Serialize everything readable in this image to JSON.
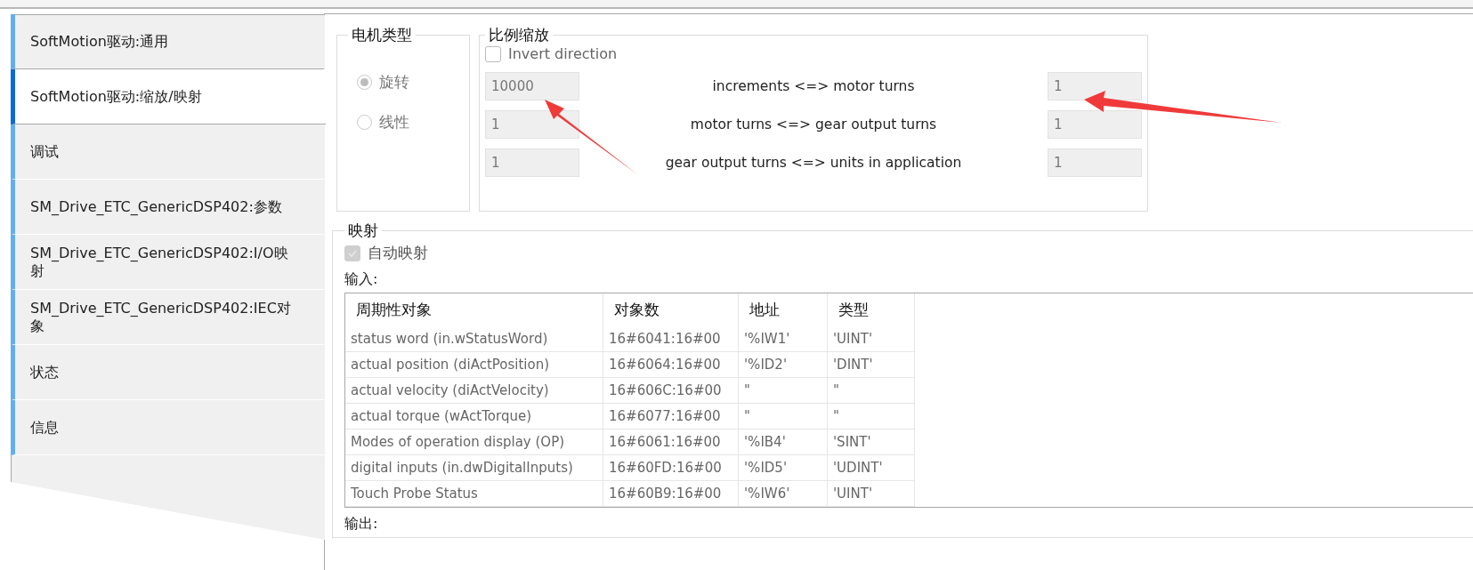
{
  "sidebar": {
    "items": [
      {
        "label": "SoftMotion驱动:通用",
        "selected": false
      },
      {
        "label": "SoftMotion驱动:缩放/映射",
        "selected": true
      },
      {
        "label": "调试",
        "selected": false
      },
      {
        "label": "SM_Drive_ETC_GenericDSP402:参数",
        "selected": false
      },
      {
        "label": "SM_Drive_ETC_GenericDSP402:I/O映射",
        "selected": false
      },
      {
        "label": "SM_Drive_ETC_GenericDSP402:IEC对象",
        "selected": false
      },
      {
        "label": "状态",
        "selected": false
      },
      {
        "label": "信息",
        "selected": false
      }
    ]
  },
  "motor_type": {
    "title": "电机类型",
    "disabled": true,
    "options": [
      {
        "label": "旋转",
        "selected": true
      },
      {
        "label": "线性",
        "selected": false
      }
    ]
  },
  "scaling": {
    "title": "比例缩放",
    "invert_direction": {
      "label": "Invert direction",
      "checked": false
    },
    "rows": [
      {
        "value": "10000",
        "label": "increments <=> motor turns",
        "ratio": "1"
      },
      {
        "value": "1",
        "label": "motor turns <=> gear output turns",
        "ratio": "1"
      },
      {
        "value": "1",
        "label": "gear output turns <=> units in application",
        "ratio": "1"
      }
    ]
  },
  "mapping": {
    "title": "映射",
    "auto_mapping": {
      "label": "自动映射",
      "checked": true,
      "disabled": true
    },
    "inputs_label": "输入:",
    "table": {
      "columns": [
        "周期性对象",
        "对象数",
        "地址",
        "类型"
      ],
      "rows": [
        [
          "status word (in.wStatusWord)",
          "16#6041:16#00",
          "'%IW1'",
          "'UINT'"
        ],
        [
          "actual position (diActPosition)",
          "16#6064:16#00",
          "'%ID2'",
          "'DINT'"
        ],
        [
          "actual velocity (diActVelocity)",
          "16#606C:16#00",
          "\"",
          "\""
        ],
        [
          "actual torque (wActTorque)",
          "16#6077:16#00",
          "\"",
          "\""
        ],
        [
          "Modes of operation display (OP)",
          "16#6061:16#00",
          "'%IB4'",
          "'SINT'"
        ],
        [
          "digital inputs (in.dwDigitalInputs)",
          "16#60FD:16#00",
          "'%ID5'",
          "'UDINT'"
        ],
        [
          "Touch Probe Status",
          "16#60B9:16#00",
          "'%IW6'",
          "'UINT'"
        ]
      ]
    },
    "outputs_label": "输出:"
  }
}
